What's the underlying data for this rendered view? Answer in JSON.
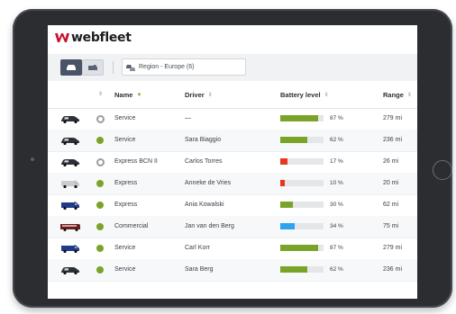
{
  "brand": {
    "name": "webfleet",
    "color": "#c8102e"
  },
  "filter": {
    "region_label": "Region - Europe (6)"
  },
  "table": {
    "columns": [
      {
        "label": "Name",
        "sort_icon": "sort-asc-icon"
      },
      {
        "label": "Driver",
        "sort_icon": "sort-icon"
      },
      {
        "label": "Battery level",
        "sort_icon": "sort-icon"
      },
      {
        "label": "Range",
        "sort_icon": "sort-icon"
      }
    ],
    "rows": [
      {
        "vehicle_icon": "car-icon",
        "vehicle_color": "#2d3035",
        "status": "offline",
        "name": "Service",
        "driver": "—",
        "battery_pct": 87,
        "battery_label": "87 %",
        "range": "279 mi"
      },
      {
        "vehicle_icon": "car-icon",
        "vehicle_color": "#2d3035",
        "status": "online",
        "name": "Service",
        "driver": "Sara Biaggio",
        "battery_pct": 62,
        "battery_label": "62 %",
        "range": "236 mi"
      },
      {
        "vehicle_icon": "car-icon",
        "vehicle_color": "#2d3035",
        "status": "offline",
        "name": "Express BCN II",
        "driver": "Carlos Torres",
        "battery_pct": 17,
        "battery_label": "17 %",
        "range": "26 mi"
      },
      {
        "vehicle_icon": "van-icon",
        "vehicle_color": "#c9ccd1",
        "status": "online",
        "name": "Express",
        "driver": "Anneke de Vries",
        "battery_pct": 10,
        "battery_label": "10 %",
        "range": "20 mi"
      },
      {
        "vehicle_icon": "van-icon",
        "vehicle_color": "#233a86",
        "status": "online",
        "name": "Express",
        "driver": "Ania Kowalski",
        "battery_pct": 30,
        "battery_label": "30 %",
        "range": "62 mi"
      },
      {
        "vehicle_icon": "bus-icon",
        "vehicle_color": "#6b1f1f",
        "status": "online",
        "name": "Commercial",
        "driver": "Jan van den Berg",
        "battery_pct": 34,
        "battery_label": "34 %",
        "range": "75 mi"
      },
      {
        "vehicle_icon": "van-icon",
        "vehicle_color": "#233a86",
        "status": "online",
        "name": "Service",
        "driver": "Carl Korr",
        "battery_pct": 87,
        "battery_label": "87 %",
        "range": "279 mi"
      },
      {
        "vehicle_icon": "car-icon",
        "vehicle_color": "#2d3035",
        "status": "online",
        "name": "Service",
        "driver": "Sara Berg",
        "battery_pct": 62,
        "battery_label": "62 %",
        "range": "236 mi"
      }
    ]
  },
  "colors": {
    "status_online": "#7aa429",
    "status_offline": "#9a9da3",
    "battery_high": "#7aa429",
    "battery_low": "#e8361f",
    "battery_charging": "#2ea3f2"
  }
}
